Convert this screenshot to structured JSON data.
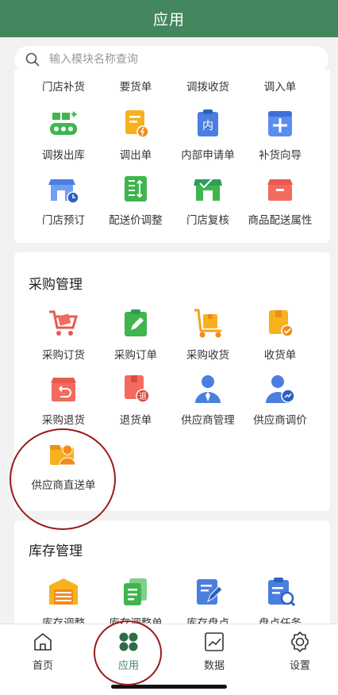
{
  "header": {
    "title": "应用"
  },
  "search": {
    "placeholder": "输入模块名称查询"
  },
  "store_section": {
    "top_row": [
      "门店补货",
      "要货单",
      "调拨收货",
      "调入单"
    ],
    "row2": [
      {
        "label": "调拨出库",
        "icon": "conveyor-icon"
      },
      {
        "label": "调出单",
        "icon": "document-out-icon"
      },
      {
        "label": "内部申请单",
        "icon": "internal-request-icon"
      },
      {
        "label": "补货向导",
        "icon": "replenish-guide-icon"
      }
    ],
    "row3": [
      {
        "label": "门店预订",
        "icon": "store-clock-icon"
      },
      {
        "label": "配送价调整",
        "icon": "price-adjust-icon"
      },
      {
        "label": "门店复核",
        "icon": "store-review-icon"
      },
      {
        "label": "商品配送属性",
        "icon": "box-attribute-icon"
      }
    ]
  },
  "purchase_section": {
    "title": "采购管理",
    "items": [
      {
        "label": "采购订货",
        "icon": "shopping-cart-icon"
      },
      {
        "label": "采购订单",
        "icon": "order-edit-icon"
      },
      {
        "label": "采购收货",
        "icon": "hand-truck-icon"
      },
      {
        "label": "收货单",
        "icon": "receipt-check-icon"
      },
      {
        "label": "采购退货",
        "icon": "return-box-icon"
      },
      {
        "label": "退货单",
        "icon": "return-document-icon"
      },
      {
        "label": "供应商管理",
        "icon": "supplier-person-icon"
      },
      {
        "label": "供应商调价",
        "icon": "supplier-price-icon"
      },
      {
        "label": "供应商直送单",
        "icon": "supplier-direct-icon"
      }
    ]
  },
  "inventory_section": {
    "title": "库存管理",
    "items": [
      {
        "label": "库存调整",
        "icon": "warehouse-icon"
      },
      {
        "label": "库存调整单",
        "icon": "adjust-document-icon"
      },
      {
        "label": "库存盘点",
        "icon": "inventory-check-icon"
      },
      {
        "label": "盘点任务",
        "icon": "count-task-icon"
      }
    ]
  },
  "tabbar": {
    "tabs": [
      {
        "label": "首页",
        "icon": "home-icon"
      },
      {
        "label": "应用",
        "icon": "apps-icon",
        "active": true
      },
      {
        "label": "数据",
        "icon": "chart-icon"
      },
      {
        "label": "设置",
        "icon": "gear-icon"
      }
    ]
  },
  "colors": {
    "brand": "#44865e",
    "annotation": "#9b1b1b"
  }
}
